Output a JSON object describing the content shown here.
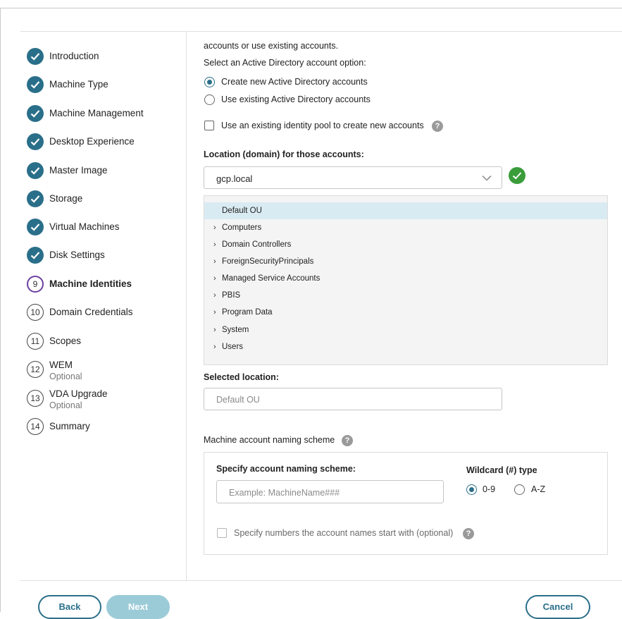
{
  "steps": [
    {
      "num": "1",
      "label": "Introduction",
      "status": "done"
    },
    {
      "num": "2",
      "label": "Machine Type",
      "status": "done"
    },
    {
      "num": "3",
      "label": "Machine Management",
      "status": "done"
    },
    {
      "num": "4",
      "label": "Desktop Experience",
      "status": "done"
    },
    {
      "num": "5",
      "label": "Master Image",
      "status": "done"
    },
    {
      "num": "6",
      "label": "Storage",
      "status": "done"
    },
    {
      "num": "7",
      "label": "Virtual Machines",
      "status": "done"
    },
    {
      "num": "8",
      "label": "Disk Settings",
      "status": "done"
    },
    {
      "num": "9",
      "label": "Machine Identities",
      "status": "current"
    },
    {
      "num": "10",
      "label": "Domain Credentials",
      "status": "todo"
    },
    {
      "num": "11",
      "label": "Scopes",
      "status": "todo"
    },
    {
      "num": "12",
      "label": "WEM",
      "sub": "Optional",
      "status": "todo"
    },
    {
      "num": "13",
      "label": "VDA Upgrade",
      "sub": "Optional",
      "status": "todo"
    },
    {
      "num": "14",
      "label": "Summary",
      "status": "todo"
    }
  ],
  "main": {
    "intro_tail": "accounts or use existing accounts.",
    "ad_prompt": "Select an Active Directory account option:",
    "ad_options": [
      {
        "label": "Create new Active Directory accounts",
        "selected": true
      },
      {
        "label": "Use existing Active Directory accounts",
        "selected": false
      }
    ],
    "identity_pool_label": "Use an existing identity pool to create new accounts",
    "location_label": "Location (domain) for those accounts:",
    "domain_value": "gcp.local",
    "ou_tree": [
      {
        "label": "Default OU",
        "selected": true,
        "expandable": false
      },
      {
        "label": "Computers",
        "selected": false,
        "expandable": true
      },
      {
        "label": "Domain Controllers",
        "selected": false,
        "expandable": true
      },
      {
        "label": "ForeignSecurityPrincipals",
        "selected": false,
        "expandable": true
      },
      {
        "label": "Managed Service Accounts",
        "selected": false,
        "expandable": true
      },
      {
        "label": "PBIS",
        "selected": false,
        "expandable": true
      },
      {
        "label": "Program Data",
        "selected": false,
        "expandable": true
      },
      {
        "label": "System",
        "selected": false,
        "expandable": true
      },
      {
        "label": "Users",
        "selected": false,
        "expandable": true
      }
    ],
    "selected_location_label": "Selected location:",
    "selected_location_placeholder": "Default OU",
    "naming_scheme_label": "Machine account naming scheme",
    "naming": {
      "specify_label": "Specify account naming scheme:",
      "placeholder": "Example: MachineName###",
      "wildcard_label": "Wildcard (#) type",
      "wildcard_options": [
        {
          "label": "0-9",
          "selected": true
        },
        {
          "label": "A-Z",
          "selected": false
        }
      ],
      "start_numbers_label": "Specify numbers the account names start with (optional)"
    }
  },
  "footer": {
    "back": "Back",
    "next": "Next",
    "cancel": "Cancel"
  },
  "colors": {
    "accent": "#2a6f8a",
    "current_step": "#6b3fa0",
    "valid": "#3a9d3a",
    "selected_row": "#d9ebf2"
  }
}
